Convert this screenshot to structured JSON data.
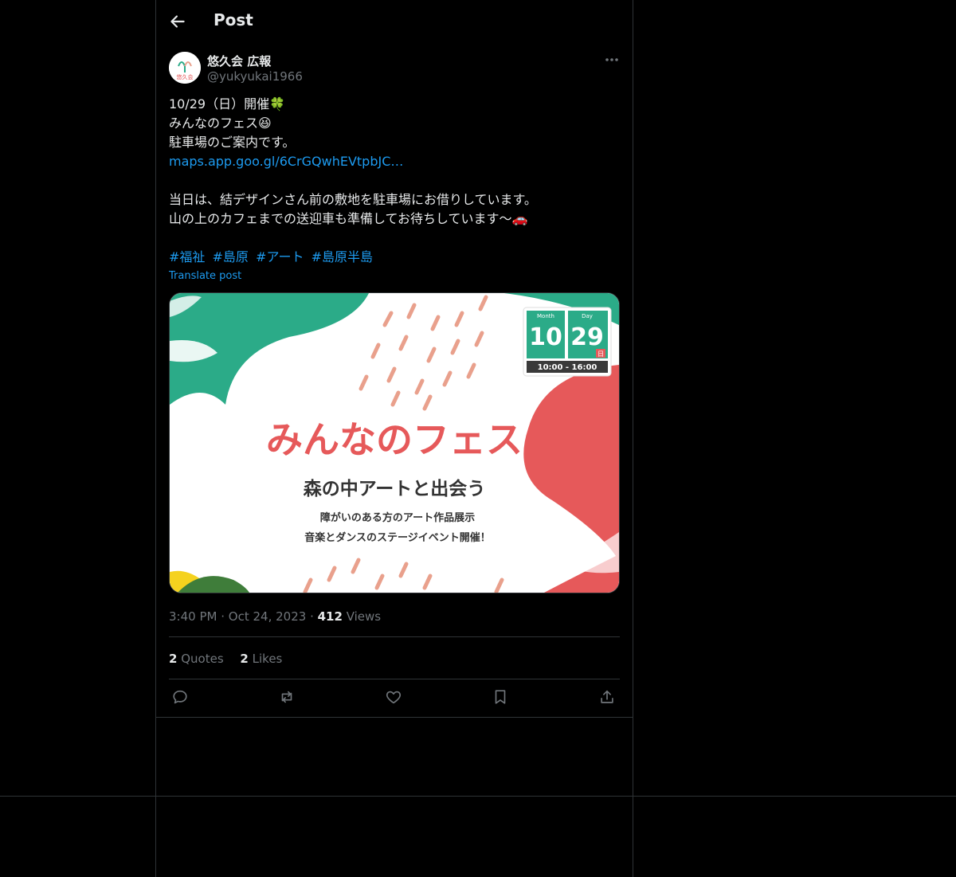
{
  "header": {
    "title": "Post"
  },
  "author": {
    "display_name": "悠久会 広報",
    "handle": "@yukyukai1966",
    "avatar_text": "悠久会"
  },
  "tweet": {
    "lines": [
      "10/29（日）開催🍀",
      "みんなのフェス😆",
      "駐車場のご案内です。"
    ],
    "link": "maps.app.goo.gl/6CrGQwhEVtpbJC…",
    "body_lines": [
      "当日は、結デザインさん前の敷地を駐車場にお借りしています。",
      "山の上のカフェまでの送迎車も準備してお待ちしています〜🚗"
    ],
    "hashtags": [
      "#福祉",
      "#島原",
      "#アート",
      "#島原半島"
    ],
    "translate": "Translate post"
  },
  "media": {
    "title": "みんなのフェス",
    "subtitle": "森の中アートと出会う",
    "line1": "障がいのある方のアート作品展示",
    "line2": "音楽とダンスのステージイベント開催！",
    "month_label": "Month",
    "day_label": "Day",
    "month": "10",
    "day": "29",
    "weekday": "日",
    "time": "10:00 - 16:00",
    "colors": {
      "green": "#2bab88",
      "coral": "#e6595a",
      "pink": "#e9a08c"
    }
  },
  "meta": {
    "time": "3:40 PM",
    "date": "Oct 24, 2023",
    "views_count": "412",
    "views_label": "Views"
  },
  "stats": {
    "quotes_count": "2",
    "quotes_label": "Quotes",
    "likes_count": "2",
    "likes_label": "Likes"
  },
  "actions": [
    "reply-icon",
    "repost-icon",
    "like-icon",
    "bookmark-icon",
    "share-icon"
  ]
}
